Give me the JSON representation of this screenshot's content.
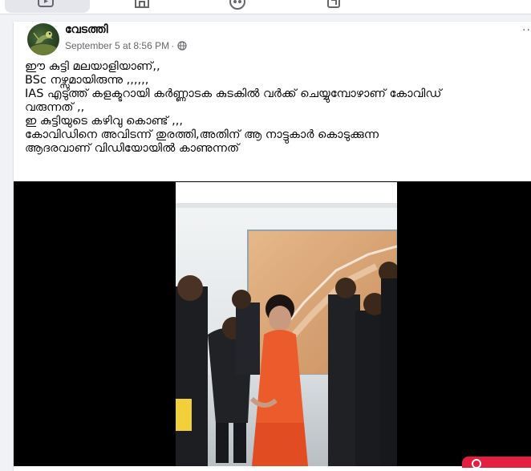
{
  "nav": {
    "icons": [
      "watch-icon",
      "marketplace-icon",
      "groups-icon",
      "gaming-icon"
    ]
  },
  "post": {
    "author": "വേടത്തി",
    "timestamp": "September 5 at 8:56 PM",
    "separator": "·",
    "privacy_icon": "globe-icon",
    "more_label": "···",
    "text_lines": [
      "ഈ കുട്ടി മലയാളിയാണ്,,",
      "BSc നഴ്സുമായിരുന്നു ,,,,,,",
      "IAS എടുത്ത്   കളക്ടറായി കർണ്ണാടക കുടകിൽ വർക്ക് ചെയ്യുമ്പോഴാണ് കോവിഡ്",
      "വരുന്നത് ,,",
      "ഇ കുട്ടിയുടെ കഴിവു കൊണ്ട് ,,,",
      "കോവിഡിനെ അവിടന്ന് തുരത്തി,അതിന് ആ നാട്ടുകാർ കൊടുക്കുന്ന",
      "ആദരവാണ് വിഡിയോയിൽ കാണുന്നത്"
    ],
    "video_label": "video-player"
  },
  "colors": {
    "page_bg": "#f0f2f5",
    "card_bg": "#ffffff",
    "text": "#050505",
    "meta": "#65676b",
    "accent_red": "#e41e3f"
  }
}
